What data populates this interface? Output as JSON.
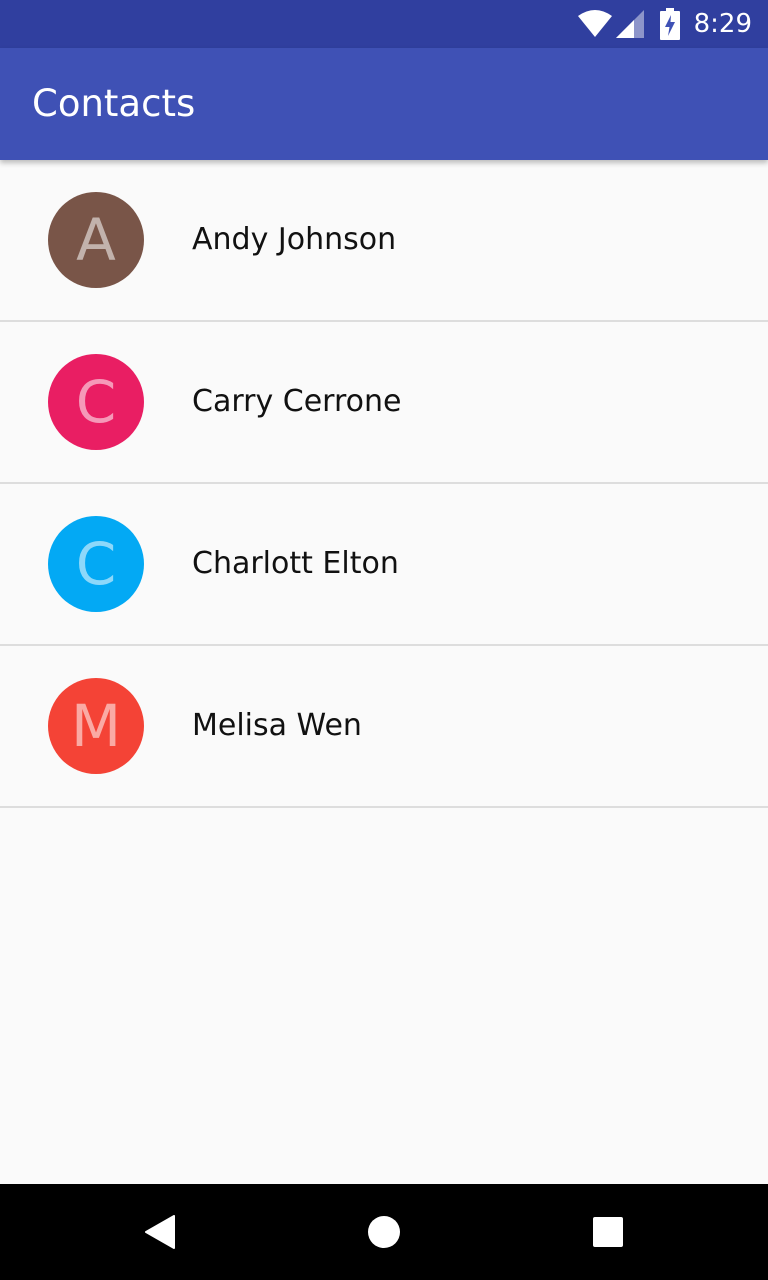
{
  "status_bar": {
    "time": "8:29",
    "icons": [
      "wifi-icon",
      "cell-signal-icon",
      "battery-charging-icon"
    ]
  },
  "app_bar": {
    "title": "Contacts"
  },
  "contacts": [
    {
      "initial": "A",
      "name": "Andy Johnson",
      "color": "#795548"
    },
    {
      "initial": "C",
      "name": "Carry Cerrone",
      "color": "#E91E63"
    },
    {
      "initial": "C",
      "name": "Charlott Elton",
      "color": "#03A9F4"
    },
    {
      "initial": "M",
      "name": "Melisa Wen",
      "color": "#F44336"
    }
  ],
  "nav_bar": {
    "icons": [
      "back-icon",
      "home-icon",
      "recents-icon"
    ]
  },
  "colors": {
    "status_bar": "#303F9F",
    "app_bar": "#3F51B5",
    "background": "#FAFAFA",
    "divider": "#DDDDDD"
  }
}
